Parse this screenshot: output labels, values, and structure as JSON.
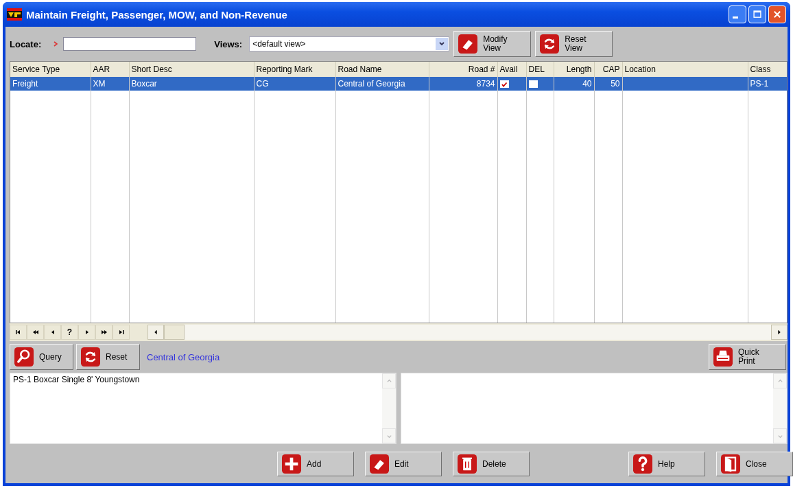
{
  "window": {
    "title": "Maintain Freight, Passenger, MOW, and Non-Revenue"
  },
  "toolbar": {
    "locate_label": "Locate:",
    "views_label": "Views:",
    "views_value": "<default view>",
    "buttons": [
      {
        "kind": "modify",
        "label": "Modify View"
      },
      {
        "kind": "reset",
        "label": "Reset View"
      }
    ]
  },
  "table": {
    "columns": [
      {
        "label": "Service Type"
      },
      {
        "label": "AAR"
      },
      {
        "label": "Short Desc"
      },
      {
        "label": "Reporting Mark"
      },
      {
        "label": "Road Name"
      },
      {
        "label": "Road #"
      },
      {
        "label": "Avail"
      },
      {
        "label": "DEL"
      },
      {
        "label": "Length"
      },
      {
        "label": "CAP"
      },
      {
        "label": "Location"
      },
      {
        "label": "Class"
      }
    ],
    "rows": [
      {
        "selected": true,
        "cells": [
          {
            "kind": "text",
            "text": "Freight"
          },
          {
            "kind": "text",
            "text": "XM"
          },
          {
            "kind": "text",
            "text": "Boxcar"
          },
          {
            "kind": "text",
            "text": "CG"
          },
          {
            "kind": "text",
            "text": "Central of Georgia"
          },
          {
            "kind": "text",
            "text": "8734"
          },
          {
            "kind": "check",
            "checked": true
          },
          {
            "kind": "check",
            "checked": false
          },
          {
            "kind": "text",
            "text": "40"
          },
          {
            "kind": "text",
            "text": "50"
          },
          {
            "kind": "empty"
          },
          {
            "kind": "text",
            "text": "PS-1"
          }
        ]
      }
    ]
  },
  "navigator": {
    "buttons": [
      {
        "kind": "first"
      },
      {
        "kind": "prev-page"
      },
      {
        "kind": "prev"
      },
      {
        "kind": "text",
        "label": "?"
      },
      {
        "kind": "next"
      },
      {
        "kind": "next-page"
      },
      {
        "kind": "last"
      }
    ]
  },
  "action_bar": {
    "buttons": [
      {
        "kind": "query",
        "label": "Query"
      },
      {
        "kind": "reset",
        "label": "Reset"
      }
    ],
    "road_name": "Central of Georgia",
    "print_button": {
      "kind": "print",
      "label": "Quick Print"
    }
  },
  "notes": {
    "text": "PS-1 Boxcar Single 8' Youngstown"
  },
  "footer": {
    "record_buttons": [
      {
        "kind": "add",
        "label": "Add"
      },
      {
        "kind": "edit",
        "label": "Edit"
      },
      {
        "kind": "delete",
        "label": "Delete"
      }
    ],
    "window_buttons": [
      {
        "kind": "help",
        "label": "Help"
      },
      {
        "kind": "close",
        "label": "Close"
      }
    ]
  }
}
